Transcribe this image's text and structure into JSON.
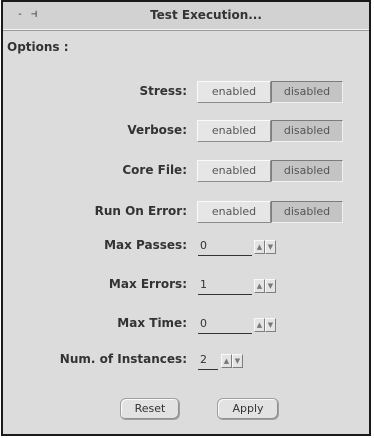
{
  "window": {
    "title": "Test Execution...",
    "menu_glyph": "- ⊣"
  },
  "options": {
    "label": "Options :"
  },
  "toggles": [
    {
      "label": "Stress:",
      "enabled_label": "enabled",
      "disabled_label": "disabled",
      "selected": "disabled"
    },
    {
      "label": "Verbose:",
      "enabled_label": "enabled",
      "disabled_label": "disabled",
      "selected": "disabled"
    },
    {
      "label": "Core File:",
      "enabled_label": "enabled",
      "disabled_label": "disabled",
      "selected": "disabled"
    },
    {
      "label": "Run On Error:",
      "enabled_label": "enabled",
      "disabled_label": "disabled",
      "selected": "disabled"
    }
  ],
  "numeric_fields": [
    {
      "label": "Max Passes:",
      "value": "0"
    },
    {
      "label": "Max Errors:",
      "value": "1"
    },
    {
      "label": "Max Time:",
      "value": "0"
    },
    {
      "label": "Num. of Instances:",
      "value": "2"
    }
  ],
  "stepper_glyphs": {
    "up": "▲",
    "down": "▼"
  },
  "buttons": {
    "reset": "Reset",
    "apply": "Apply"
  }
}
